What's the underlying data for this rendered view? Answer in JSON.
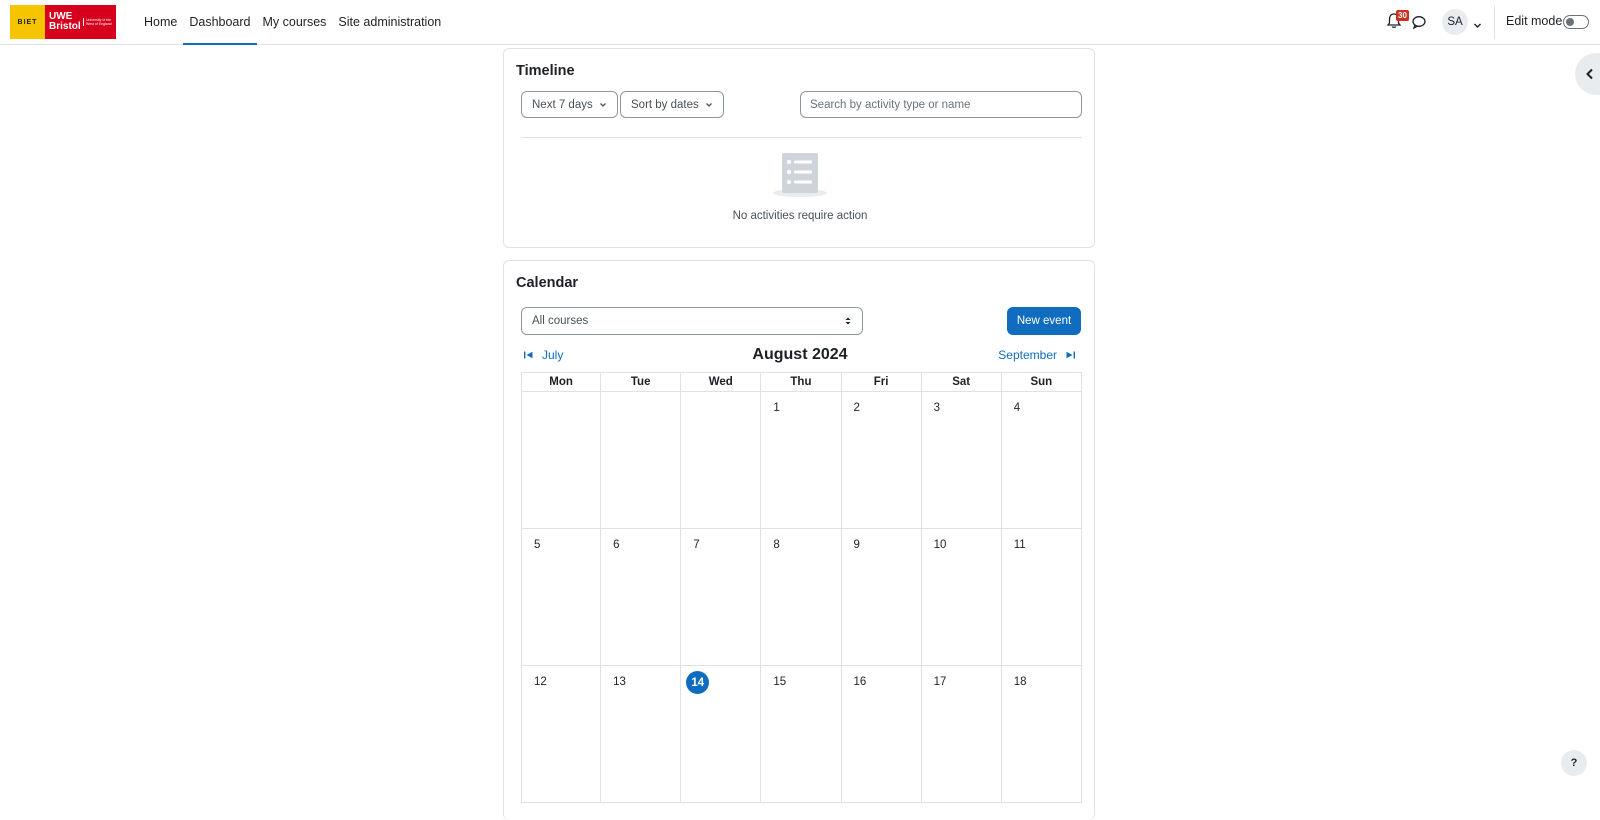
{
  "logo": {
    "biet_text": "BIET",
    "uwe_line1": "UWE",
    "uwe_line2": "Bristol",
    "uwe_small": "University of the West of England"
  },
  "nav": {
    "links": [
      {
        "label": "Home",
        "active": false
      },
      {
        "label": "Dashboard",
        "active": true
      },
      {
        "label": "My courses",
        "active": false
      },
      {
        "label": "Site administration",
        "active": false
      }
    ],
    "notification_count": "30",
    "avatar_initials": "SA",
    "edit_mode_label": "Edit mode",
    "edit_mode_on": false
  },
  "timeline": {
    "title": "Timeline",
    "filter_label": "Next 7 days",
    "sort_label": "Sort by dates",
    "search_placeholder": "Search by activity type or name",
    "empty_text": "No activities require action"
  },
  "calendar": {
    "title": "Calendar",
    "course_filter": "All courses",
    "new_event_label": "New event",
    "prev_month": "July",
    "current_month": "August 2024",
    "next_month": "September",
    "weekdays": [
      "Mon",
      "Tue",
      "Wed",
      "Thu",
      "Fri",
      "Sat",
      "Sun"
    ],
    "weeks": [
      [
        "",
        "",
        "",
        "1",
        "2",
        "3",
        "4"
      ],
      [
        "5",
        "6",
        "7",
        "8",
        "9",
        "10",
        "11"
      ],
      [
        "12",
        "13",
        "14",
        "15",
        "16",
        "17",
        "18"
      ]
    ],
    "today": "14"
  },
  "help_label": "?",
  "colors": {
    "accent": "#0f6cbf",
    "badge": "#ca3120",
    "logo_yellow": "#f6c500",
    "logo_red": "#d6001c"
  }
}
